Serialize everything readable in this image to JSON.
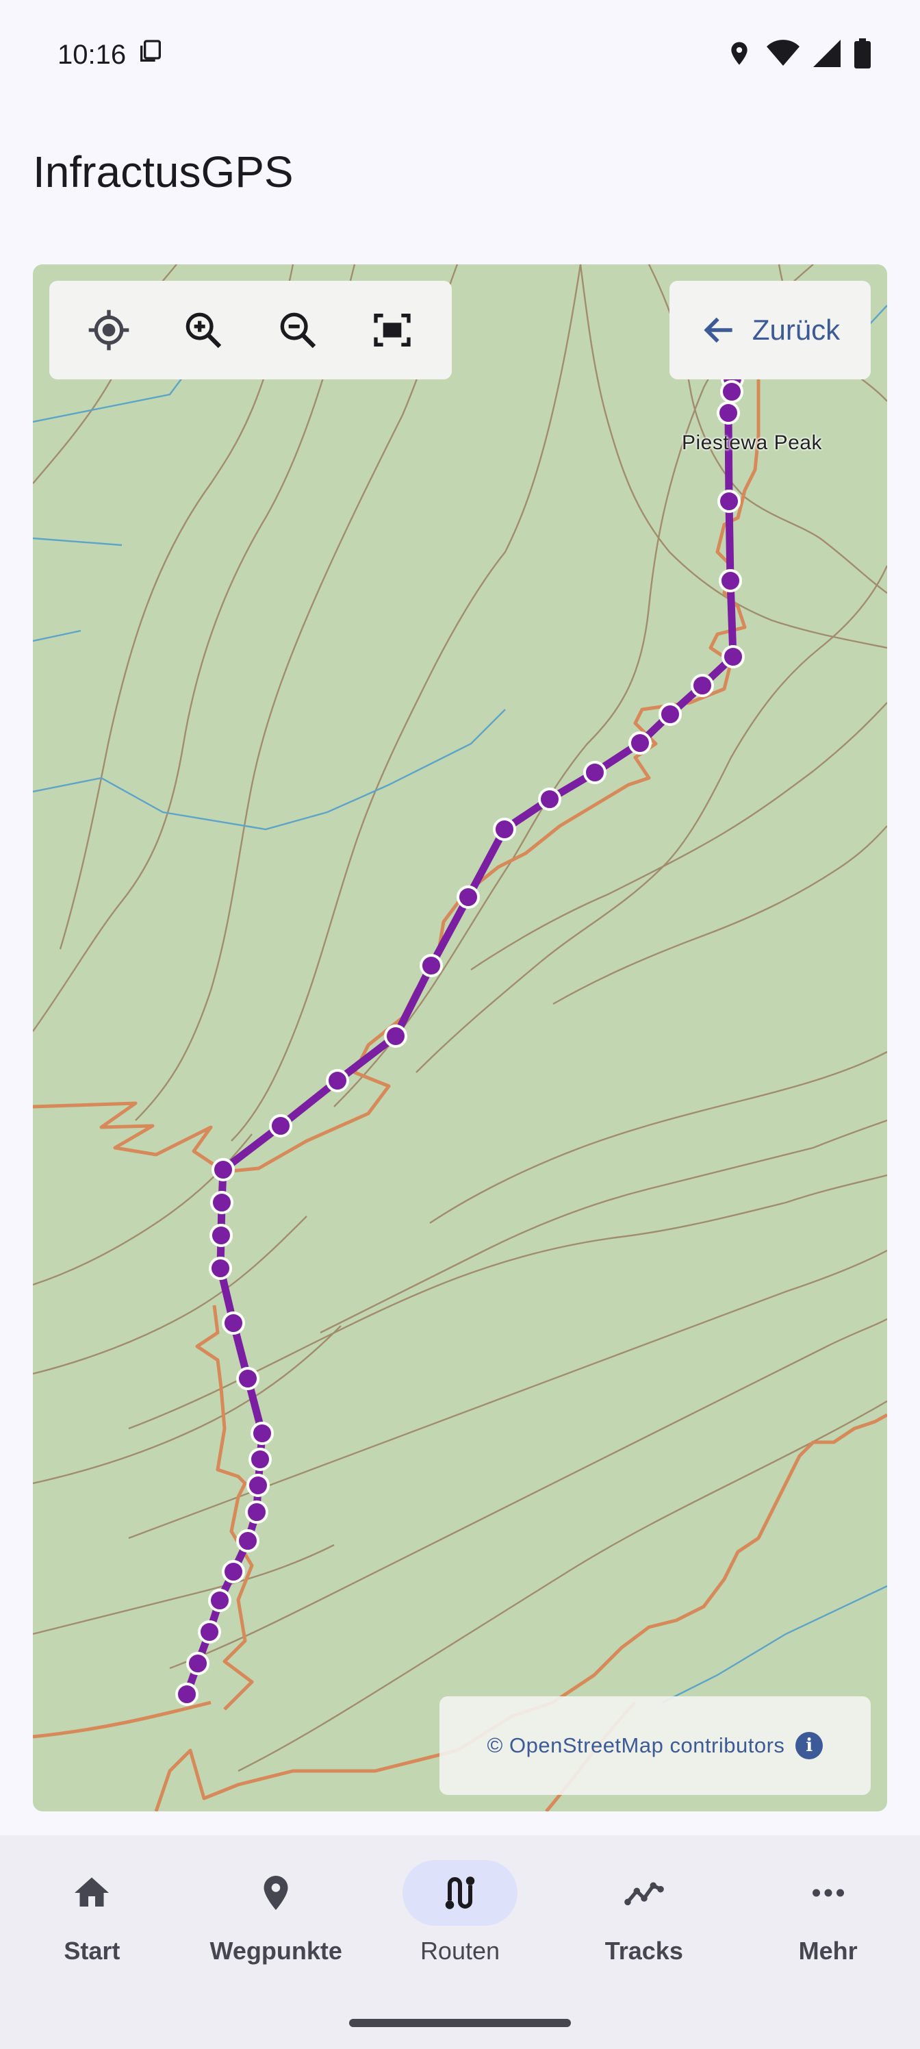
{
  "status_bar": {
    "time": "10:16",
    "icons": [
      "clipboard-icon",
      "location-icon",
      "wifi-icon",
      "signal-icon",
      "battery-icon"
    ]
  },
  "app": {
    "title": "InfractusGPS"
  },
  "map": {
    "controls": [
      "my-location-icon",
      "zoom-in-icon",
      "zoom-out-icon",
      "fit-route-icon"
    ],
    "back_label": "Zurück",
    "peak_label": "Piestewa Peak",
    "attribution": "© OpenStreetMap contributors",
    "colors": {
      "land": "#c2d7b1",
      "contour": "#9c8163",
      "trail": "#d7895a",
      "route": "#7b1fa2",
      "water": "#5ea3c8"
    }
  },
  "bottom_nav": {
    "items": [
      {
        "label": "Start",
        "icon": "home-icon",
        "active": false
      },
      {
        "label": "Wegpunkte",
        "icon": "place-icon",
        "active": false
      },
      {
        "label": "Routen",
        "icon": "route-icon",
        "active": true
      },
      {
        "label": "Tracks",
        "icon": "timeline-icon",
        "active": false
      },
      {
        "label": "Mehr",
        "icon": "more-horiz-icon",
        "active": false
      }
    ]
  }
}
